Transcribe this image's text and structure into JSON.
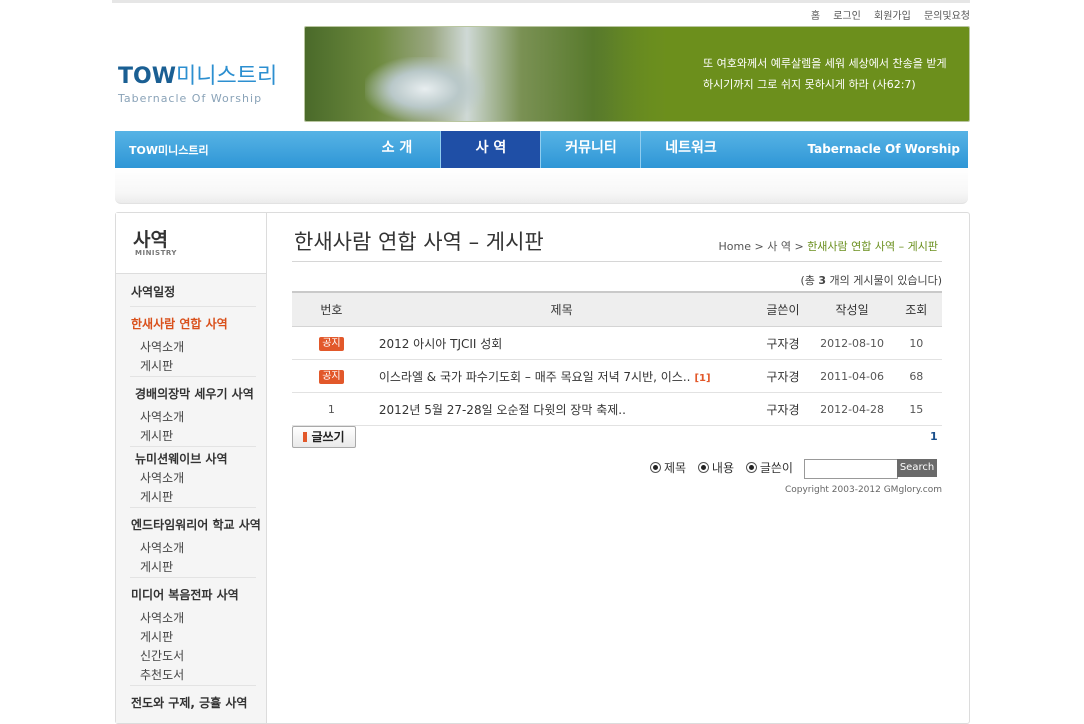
{
  "top_links": [
    "홈",
    "로그인",
    "회원가입",
    "문의및요청"
  ],
  "logo": {
    "main_en": "TOW",
    "main_kr": "미니스트리",
    "sub": "Tabernacle Of Worship"
  },
  "banner": {
    "verse_line1": "또 여호와께서 예루살렘을 세워 세상에서 찬송을 받게",
    "verse_line2": "하시기까지 그로 쉬지 못하시게 하라 (사62:7)"
  },
  "nav": {
    "brand": "TOW미니스트리",
    "items": [
      {
        "label": "소 개"
      },
      {
        "label": "사 역"
      },
      {
        "label": "커뮤니티"
      },
      {
        "label": "네트워크"
      }
    ],
    "active_index": 1,
    "right_label": "Tabernacle Of Worship"
  },
  "sidebar": {
    "title": "사역",
    "subtitle": "MINISTRY",
    "items": [
      "사역일정",
      "한새사람 연합 사역",
      "사역소개",
      "게시판",
      "경배의장막 세우기 사역",
      "사역소개",
      "게시판",
      "뉴미션웨이브 사역",
      "사역소개",
      "게시판",
      "엔드타임워리어 학교 사역",
      "사역소개",
      "게시판",
      "미디어 복음전파 사역",
      "사역소개",
      "게시판",
      "신간도서",
      "추천도서",
      "전도와 구제, 긍휼 사역"
    ]
  },
  "page": {
    "title": "한새사람 연합 사역 – 게시판",
    "breadcrumb_home": "Home",
    "breadcrumb_sep": ">",
    "breadcrumb_mid": "사 역",
    "breadcrumb_current": "한새사람 연합 사역 – 게시판",
    "count_prefix": "(총 ",
    "count_value": "3",
    "count_suffix": " 개의 게시물이 있습니다)"
  },
  "table": {
    "headers": [
      "번호",
      "제목",
      "글쓴이",
      "작성일",
      "조회"
    ],
    "rows": [
      {
        "num": "공지",
        "is_notice": true,
        "title": "2012 아시아 TJCII 성회",
        "comments": "",
        "author": "구자경",
        "date": "2012-08-10",
        "views": "10"
      },
      {
        "num": "공지",
        "is_notice": true,
        "title": "이스라엘 & 국가 파수기도회 – 매주 목요일 저녁 7시반, 이스..",
        "comments": "[1]",
        "author": "구자경",
        "date": "2011-04-06",
        "views": "68"
      },
      {
        "num": "1",
        "is_notice": false,
        "title": "2012년 5월 27-28일 오순절 다윗의 장막 축제..",
        "comments": "",
        "author": "구자경",
        "date": "2012-04-28",
        "views": "15"
      }
    ]
  },
  "write_button": "글쓰기",
  "pagination": {
    "current": "1"
  },
  "search": {
    "options": [
      "제목",
      "내용",
      "글쓴이"
    ],
    "button": "Search",
    "value": ""
  },
  "copyright": "Copyright 2003-2012 GMglory.com",
  "colors": {
    "nav_blue": "#2e96d6",
    "nav_active": "#1f4fa6",
    "banner_green": "#6c8f1c",
    "accent_orange": "#e2582a",
    "active_link": "#d9501b"
  }
}
